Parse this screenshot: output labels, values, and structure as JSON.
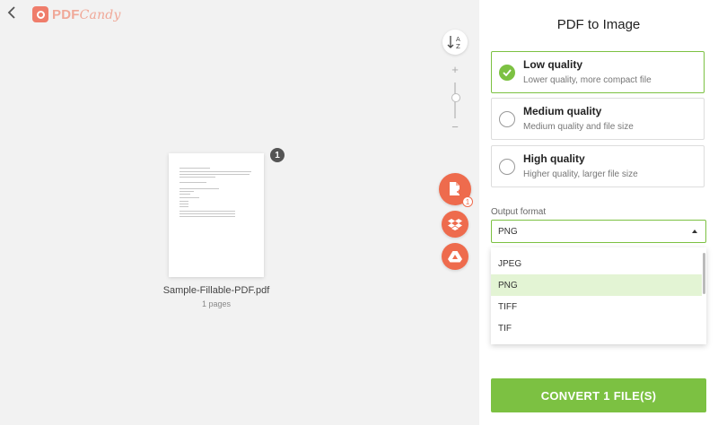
{
  "header": {
    "back_icon": "chevron-left-icon",
    "logo_part1": "PDF",
    "logo_part2": "Candy"
  },
  "toolbar": {
    "sort_icon": "sort-az-icon",
    "zoom_in_label": "+",
    "zoom_out_label": "−"
  },
  "file": {
    "name": "Sample-Fillable-PDF.pdf",
    "pages": "1 pages",
    "badge": "1"
  },
  "actions": {
    "add_file_icon": "add-file-icon",
    "add_count": "1",
    "dropbox_icon": "dropbox-icon",
    "gdrive_icon": "google-drive-icon"
  },
  "panel": {
    "title": "PDF to Image",
    "options": [
      {
        "title": "Low quality",
        "desc": "Lower quality, more compact file",
        "selected": true
      },
      {
        "title": "Medium quality",
        "desc": "Medium quality and file size",
        "selected": false
      },
      {
        "title": "High quality",
        "desc": "Higher quality, larger file size",
        "selected": false
      }
    ],
    "output_format_label": "Output format",
    "output_format_value": "PNG",
    "format_options": [
      "JPEG",
      "PNG",
      "TIFF",
      "TIF"
    ],
    "convert_label": "CONVERT 1 FILE(S)"
  },
  "colors": {
    "accent": "#7cc142",
    "brand": "#ee6b4d",
    "selected_row": "#e3f4d4"
  }
}
